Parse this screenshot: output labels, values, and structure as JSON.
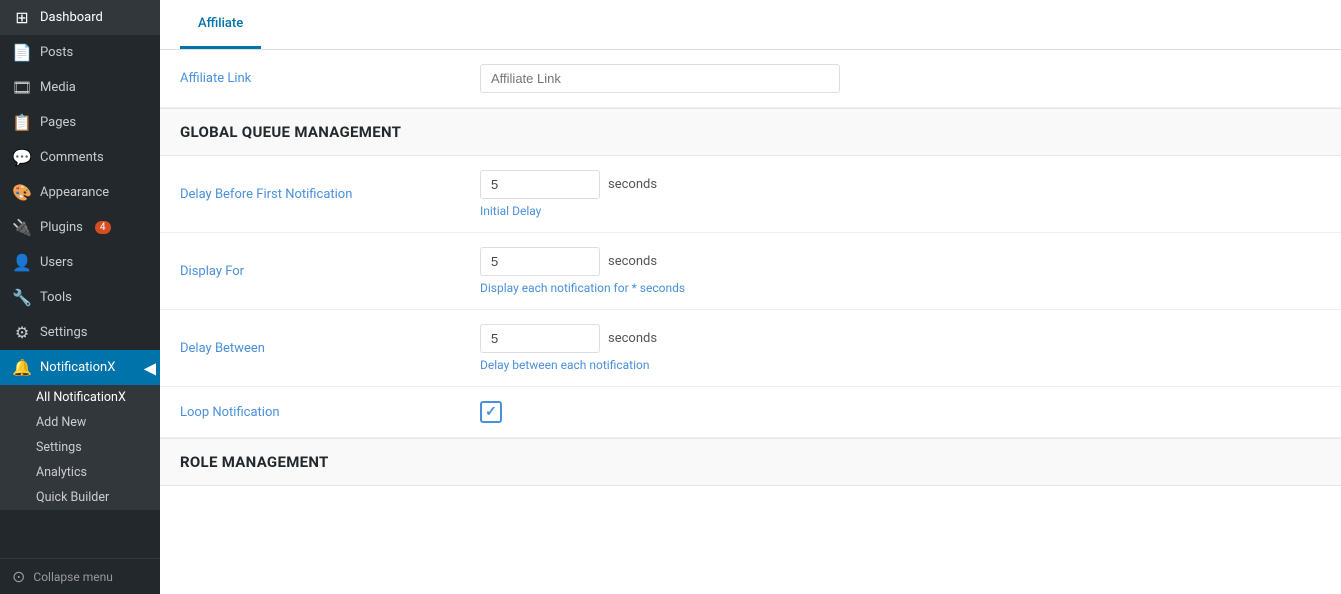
{
  "sidebar": {
    "items": [
      {
        "id": "dashboard",
        "label": "Dashboard",
        "icon": "⊞"
      },
      {
        "id": "posts",
        "label": "Posts",
        "icon": "📄"
      },
      {
        "id": "media",
        "label": "Media",
        "icon": "🎞"
      },
      {
        "id": "pages",
        "label": "Pages",
        "icon": "📋"
      },
      {
        "id": "comments",
        "label": "Comments",
        "icon": "💬"
      },
      {
        "id": "appearance",
        "label": "Appearance",
        "icon": "🎨"
      },
      {
        "id": "plugins",
        "label": "Plugins",
        "icon": "🔌",
        "badge": "4"
      },
      {
        "id": "users",
        "label": "Users",
        "icon": "👤"
      },
      {
        "id": "tools",
        "label": "Tools",
        "icon": "🔧"
      },
      {
        "id": "settings",
        "label": "Settings",
        "icon": "⚙"
      },
      {
        "id": "notificationx",
        "label": "NotificationX",
        "icon": "🔔",
        "active": true
      }
    ],
    "submenu": [
      {
        "id": "all",
        "label": "All NotificationX",
        "active": true
      },
      {
        "id": "addnew",
        "label": "Add New"
      },
      {
        "id": "settings",
        "label": "Settings"
      },
      {
        "id": "analytics",
        "label": "Analytics"
      },
      {
        "id": "quickbuilder",
        "label": "Quick Builder"
      }
    ],
    "collapse_label": "Collapse menu",
    "arrow_icon": "◀"
  },
  "tabs": [
    {
      "id": "affiliate",
      "label": "Affiliate",
      "active": true
    }
  ],
  "affiliate_link": {
    "label": "Affiliate Link",
    "placeholder": "Affiliate Link"
  },
  "global_queue": {
    "section_title": "GLOBAL QUEUE MANAGEMENT",
    "delay_first": {
      "label": "Delay Before First Notification",
      "value": "5",
      "suffix": "seconds",
      "hint": "Initial Delay"
    },
    "display_for": {
      "label": "Display For",
      "value": "5",
      "suffix": "seconds",
      "hint": "Display each notification for * seconds"
    },
    "delay_between": {
      "label": "Delay Between",
      "value": "5",
      "suffix": "seconds",
      "hint": "Delay between each notification"
    },
    "loop_notification": {
      "label": "Loop Notification",
      "checked": true,
      "check_symbol": "✓"
    }
  },
  "role_management": {
    "section_title": "ROLE MANAGEMENT"
  }
}
